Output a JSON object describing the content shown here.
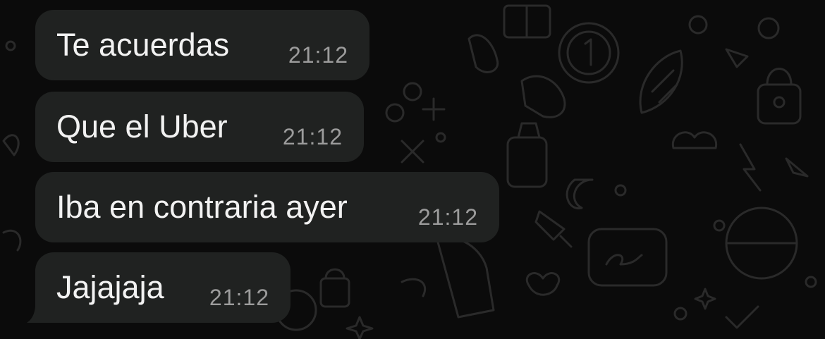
{
  "chat": {
    "messages": [
      {
        "text": "Te acuerdas",
        "time": "21:12"
      },
      {
        "text": "Que el Uber",
        "time": "21:12"
      },
      {
        "text": "Iba en contraria ayer",
        "time": "21:12"
      },
      {
        "text": "Jajajaja",
        "time": "21:12"
      }
    ]
  },
  "colors": {
    "background": "#0b0b0b",
    "bubble": "#202221",
    "message_text": "#f2f2f2",
    "timestamp_text": "#9c9c9c",
    "doodle": "#2a2a2a"
  }
}
